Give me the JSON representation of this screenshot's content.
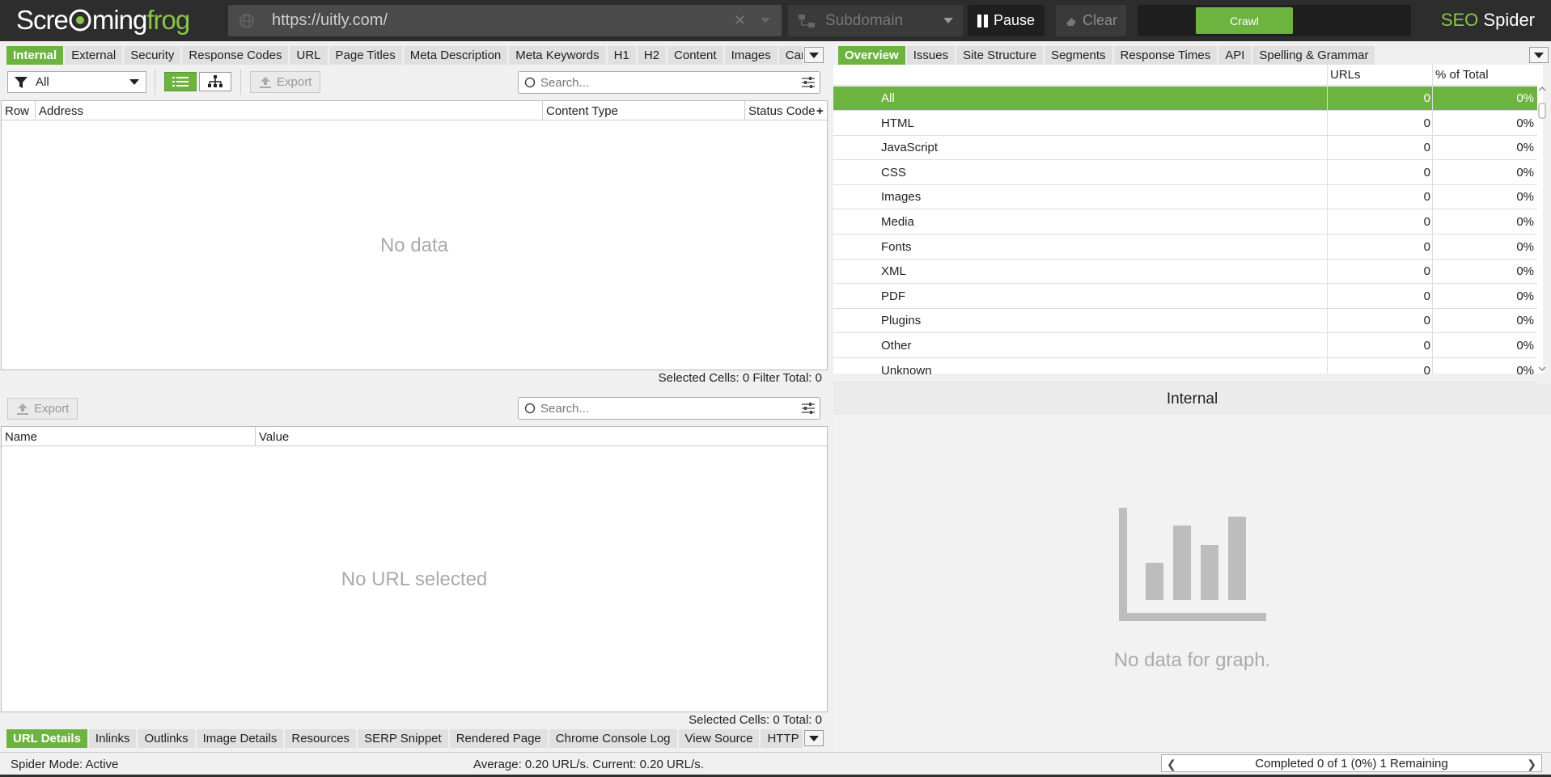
{
  "app": {
    "logo_left": "Scre",
    "logo_mid": "ming",
    "logo_right": "frog",
    "brand_seo": "SEO",
    "brand_spider": "Spider",
    "url": "https://uitly.com/",
    "mode_select": "Subdomain",
    "pause_label": "Pause",
    "clear_label": "Clear",
    "crawl_label": "Crawl"
  },
  "colors": {
    "accent": "#6db33f",
    "topbar": "#2d2d2d"
  },
  "left_tabs": [
    "Internal",
    "External",
    "Security",
    "Response Codes",
    "URL",
    "Page Titles",
    "Meta Description",
    "Meta Keywords",
    "H1",
    "H2",
    "Content",
    "Images",
    "Canoni"
  ],
  "left_toolbar": {
    "filter_value": "All",
    "export_label": "Export",
    "search_placeholder": "Search..."
  },
  "main_grid": {
    "columns": [
      "Row",
      "Address",
      "Content Type",
      "Status Code"
    ],
    "empty_message": "No data",
    "status": "Selected Cells:  0  Filter Total:  0"
  },
  "detail_toolbar": {
    "export_label": "Export",
    "search_placeholder": "Search..."
  },
  "detail_grid": {
    "columns": [
      "Name",
      "Value"
    ],
    "empty_message": "No URL selected",
    "status": "Selected Cells:  0  Total:  0"
  },
  "bottom_tabs": [
    "URL Details",
    "Inlinks",
    "Outlinks",
    "Image Details",
    "Resources",
    "SERP Snippet",
    "Rendered Page",
    "Chrome Console Log",
    "View Source",
    "HTTP Hea"
  ],
  "right_tabs": [
    "Overview",
    "Issues",
    "Site Structure",
    "Segments",
    "Response Times",
    "API",
    "Spelling & Grammar"
  ],
  "overview": {
    "col_urls": "URLs",
    "col_pct": "% of Total",
    "rows": [
      {
        "name": "All",
        "urls": "0",
        "pct": "0%"
      },
      {
        "name": "HTML",
        "urls": "0",
        "pct": "0%"
      },
      {
        "name": "JavaScript",
        "urls": "0",
        "pct": "0%"
      },
      {
        "name": "CSS",
        "urls": "0",
        "pct": "0%"
      },
      {
        "name": "Images",
        "urls": "0",
        "pct": "0%"
      },
      {
        "name": "Media",
        "urls": "0",
        "pct": "0%"
      },
      {
        "name": "Fonts",
        "urls": "0",
        "pct": "0%"
      },
      {
        "name": "XML",
        "urls": "0",
        "pct": "0%"
      },
      {
        "name": "PDF",
        "urls": "0",
        "pct": "0%"
      },
      {
        "name": "Plugins",
        "urls": "0",
        "pct": "0%"
      },
      {
        "name": "Other",
        "urls": "0",
        "pct": "0%"
      },
      {
        "name": "Unknown",
        "urls": "0",
        "pct": "0%"
      }
    ]
  },
  "chart_panel": {
    "title": "Internal",
    "empty_message": "No data for graph."
  },
  "status_bar": {
    "mode": "Spider Mode: Active",
    "rate": "Average: 0.20 URL/s. Current: 0.20 URL/s.",
    "progress": "Completed 0 of 1 (0%) 1 Remaining"
  }
}
